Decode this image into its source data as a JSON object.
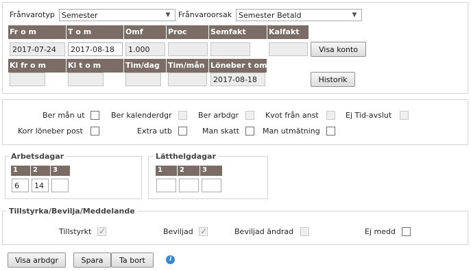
{
  "top": {
    "franvarotyp_label": "Frånvarotyp",
    "franvarotyp_value": "Semester",
    "franvaroorsak_label": "Frånvaroorsak",
    "franvaroorsak_value": "Semester Betald"
  },
  "row1": {
    "headers": [
      "Fr o m",
      "T o m",
      "Omf",
      "Proc",
      "Semfakt",
      "Kalfakt"
    ],
    "fr_o_m": "2017-07-24",
    "t_o_m": "2017-08-18",
    "omf": "1.000",
    "proc": "",
    "semfakt": "",
    "kalfakt": "",
    "visa_konto_label": "Visa konto"
  },
  "row2": {
    "headers": [
      "Kl fr o m",
      "Kl t o m",
      "Tim/dag",
      "Tim/mån",
      "Löneber t om"
    ],
    "kl_fr_o_m": "",
    "kl_t_o_m": "",
    "tim_dag": "",
    "tim_man": "",
    "loneber_t_om": "2017-08-18",
    "historik_label": "Historik"
  },
  "checks": {
    "ber_man_ut": "Ber mån ut",
    "ber_kalenderdgr": "Ber kalenderdgr",
    "ber_arbdgr": "Ber arbdgr",
    "kvot_fran_anst": "Kvot från anst",
    "ej_tid_avslut": "Ej Tid-avslut",
    "korr_loneber_post": "Korr löneber post",
    "extra_utb": "Extra utb",
    "man_skatt": "Man skatt",
    "man_utmatning": "Man utmätning"
  },
  "arbetsdagar": {
    "title": "Arbetsdagar",
    "cols": [
      "1",
      "2",
      "3"
    ],
    "values": [
      "6",
      "14",
      ""
    ]
  },
  "latthelgdagar": {
    "title": "Lätthelgdagar",
    "cols": [
      "1",
      "2",
      "3"
    ],
    "values": [
      "",
      "",
      ""
    ]
  },
  "tillstyrka": {
    "title": "Tillstyrka/Bevilja/Meddelande",
    "tillstyrkt": "Tillstyrkt",
    "beviljad": "Beviljad",
    "beviljad_andrad": "Beviljad ändrad",
    "ej_medd": "Ej medd"
  },
  "buttons": {
    "visa_arbdgr": "Visa arbdgr",
    "spara": "Spara",
    "ta_bort": "Ta bort",
    "info_glyph": "i"
  },
  "colors": {
    "header_bg": "#7b6d66",
    "disabled_bg": "#ececec",
    "info": "#3a86d6"
  }
}
